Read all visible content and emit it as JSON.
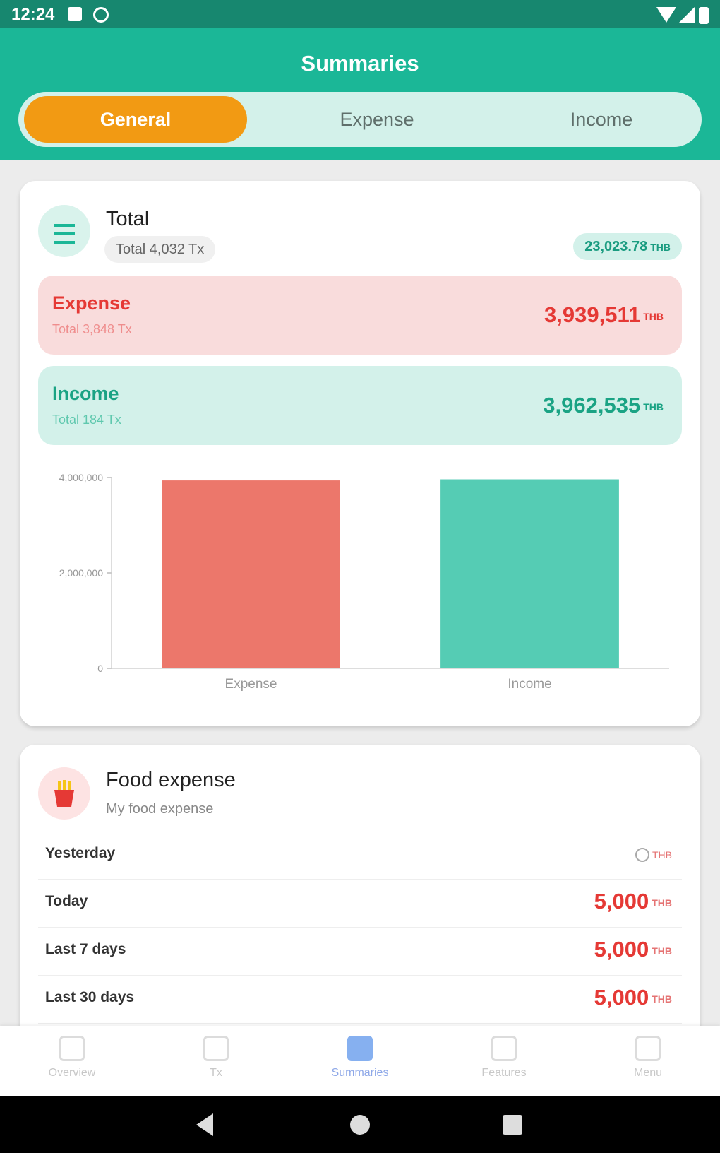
{
  "status_bar": {
    "time": "12:24"
  },
  "header": {
    "title": "Summaries",
    "tabs": [
      {
        "label": "General",
        "active": true
      },
      {
        "label": "Expense",
        "active": false
      },
      {
        "label": "Income",
        "active": false
      }
    ]
  },
  "total_card": {
    "title": "Total",
    "count_label": "Total 4,032 Tx",
    "balance": "23,023.78",
    "balance_unit": "THB",
    "expense": {
      "label": "Expense",
      "sub": "Total 3,848 Tx",
      "amount": "3,939,511",
      "unit": "THB"
    },
    "income": {
      "label": "Income",
      "sub": "Total 184 Tx",
      "amount": "3,962,535",
      "unit": "THB"
    }
  },
  "chart_data": {
    "type": "bar",
    "categories": [
      "Expense",
      "Income"
    ],
    "values": [
      3939511,
      3962535
    ],
    "ylim": [
      0,
      4000000
    ],
    "yticks": [
      0,
      2000000,
      4000000
    ],
    "ytick_labels": [
      "0",
      "2,000,000",
      "4,000,000"
    ],
    "colors": [
      "#ec776b",
      "#55ccb4"
    ],
    "grid": false
  },
  "food_card": {
    "title": "Food expense",
    "subtitle": "My food expense",
    "rows": [
      {
        "label": "Yesterday",
        "value": "0",
        "unit": "THB",
        "muted": true
      },
      {
        "label": "Today",
        "value": "5,000",
        "unit": "THB",
        "muted": false
      },
      {
        "label": "Last 7 days",
        "value": "5,000",
        "unit": "THB",
        "muted": false
      },
      {
        "label": "Last 30 days",
        "value": "5,000",
        "unit": "THB",
        "muted": false
      }
    ]
  },
  "bottom_nav": [
    {
      "label": "Overview",
      "icon": "overview-icon",
      "active": false
    },
    {
      "label": "Tx",
      "icon": "transactions-icon",
      "active": false
    },
    {
      "label": "Summaries",
      "icon": "summaries-icon",
      "active": true
    },
    {
      "label": "Features",
      "icon": "features-icon",
      "active": false
    },
    {
      "label": "Menu",
      "icon": "menu-icon",
      "active": false
    }
  ],
  "colors": {
    "header": "#1bb797",
    "accent": "#f29a13",
    "expense": "#e53935",
    "income": "#1aa384"
  }
}
